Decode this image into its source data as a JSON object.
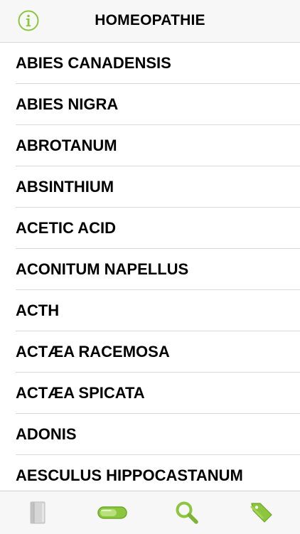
{
  "header": {
    "title": "HOMEOPATHIE",
    "info_icon": "info-circle-icon"
  },
  "list": {
    "items": [
      "ABIES CANADENSIS",
      "ABIES NIGRA",
      "ABROTANUM",
      "ABSINTHIUM",
      "ACETIC ACID",
      "ACONITUM NAPELLUS",
      "ACTH",
      "ACTÆA RACEMOSA",
      "ACTÆA SPICATA",
      "ADONIS",
      "AESCULUS HIPPOCASTANUM"
    ]
  },
  "tabbar": {
    "tabs": [
      {
        "icon": "book-icon"
      },
      {
        "icon": "toggle-pill-icon"
      },
      {
        "icon": "search-icon"
      },
      {
        "icon": "tags-icon"
      }
    ]
  },
  "colors": {
    "accent_green": "#8cc63f",
    "accent_green_dark": "#6fa82a",
    "inactive_gray": "#c8c8c8",
    "text": "#000000",
    "separator": "#d9d9d9",
    "bar_background": "#f7f7f7"
  }
}
